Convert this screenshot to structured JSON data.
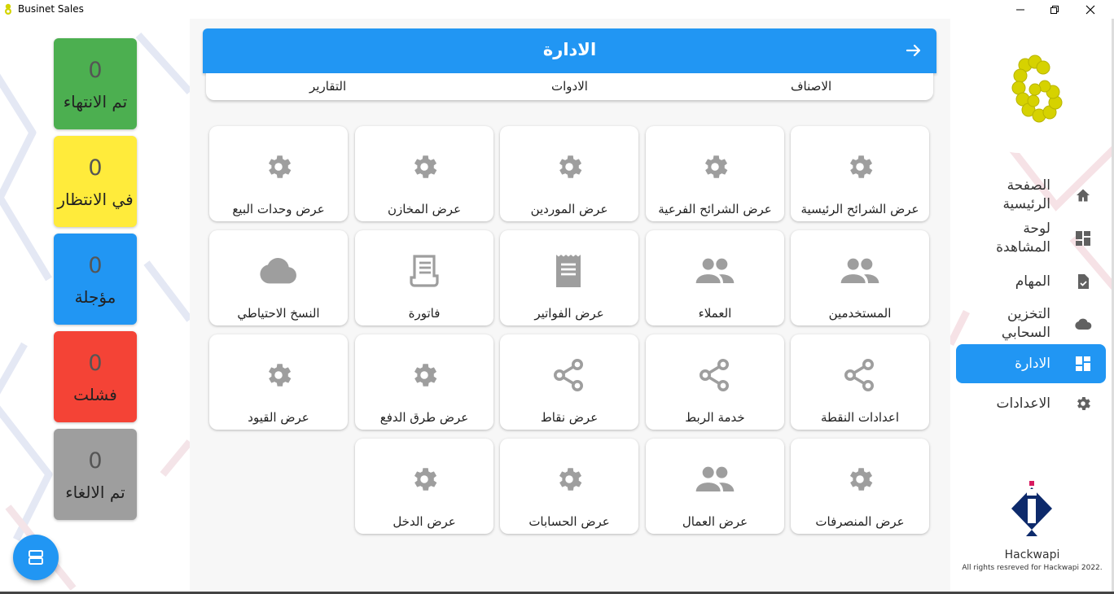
{
  "window": {
    "title": "Businet Sales"
  },
  "status_cards": [
    {
      "count": "0",
      "label": "تم الانتهاء",
      "color": "#4caf50"
    },
    {
      "count": "0",
      "label": "في الانتظار",
      "color": "#ffeb3b"
    },
    {
      "count": "0",
      "label": "مؤجلة",
      "color": "#2196f3"
    },
    {
      "count": "0",
      "label": "فشلت",
      "color": "#f44336"
    },
    {
      "count": "0",
      "label": "تم الالغاء",
      "color": "#9e9e9e"
    }
  ],
  "header": {
    "title": "الادارة"
  },
  "tabs": [
    "الاصناف",
    "الادوات",
    "التقارير"
  ],
  "tiles": [
    {
      "label": "عرض الشرائح الرئيسية",
      "icon": "gear-icon"
    },
    {
      "label": "عرض الشرائح الفرعية",
      "icon": "gear-icon"
    },
    {
      "label": "عرض الموردين",
      "icon": "gear-icon"
    },
    {
      "label": "عرض المخازن",
      "icon": "gear-icon"
    },
    {
      "label": "عرض وحدات البيع",
      "icon": "gear-icon"
    },
    {
      "label": "المستخدمين",
      "icon": "people-icon"
    },
    {
      "label": "العملاء",
      "icon": "people-icon"
    },
    {
      "label": "عرض الفواتير",
      "icon": "receipt-icon"
    },
    {
      "label": "فاتورة",
      "icon": "receipt-outline-icon"
    },
    {
      "label": "النسخ الاحتياطي",
      "icon": "cloud-icon"
    },
    {
      "label": "اعدادات النقطة",
      "icon": "share-icon"
    },
    {
      "label": "خدمة الربط",
      "icon": "share-icon"
    },
    {
      "label": "عرض نقاط",
      "icon": "share-icon"
    },
    {
      "label": "عرض طرق الدفع",
      "icon": "gear-icon"
    },
    {
      "label": "عرض القيود",
      "icon": "gear-icon"
    },
    {
      "label": "عرض المنصرفات",
      "icon": "gear-icon"
    },
    {
      "label": "عرض العمال",
      "icon": "people-icon"
    },
    {
      "label": "عرض الحسابات",
      "icon": "gear-icon"
    },
    {
      "label": "عرض الدخل",
      "icon": "gear-icon"
    }
  ],
  "nav": [
    {
      "label": "الصفحة\nالرئيسية",
      "icon": "home-icon",
      "active": false
    },
    {
      "label": "لوحة\nالمشاهدة",
      "icon": "dashboard-icon",
      "active": false
    },
    {
      "label": "المهام",
      "icon": "task-icon",
      "active": false
    },
    {
      "label": "التخزين\nالسحابي",
      "icon": "cloud-icon",
      "active": false
    },
    {
      "label": "الادارة",
      "icon": "dashboard-icon",
      "active": true
    },
    {
      "label": "الاعدادات",
      "icon": "gear-icon",
      "active": false
    }
  ],
  "brand": {
    "name": "Hackwapi",
    "copyright": "All rights resreved for Hackwapi 2022."
  },
  "colors": {
    "accent": "#2196f3",
    "icon_gray": "#9e9e9e"
  }
}
